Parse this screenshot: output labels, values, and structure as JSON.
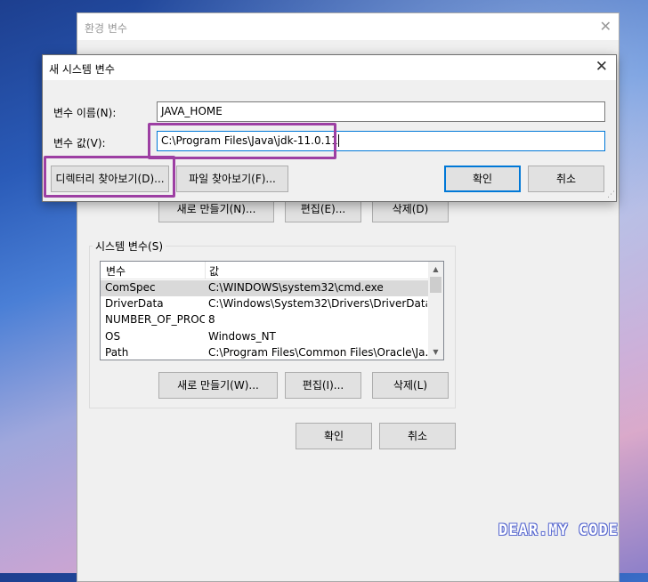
{
  "env_window": {
    "title": "환경 변수",
    "user_section": {
      "new_label": "새로 만들기(N)...",
      "edit_label": "편집(E)...",
      "delete_label": "삭제(D)"
    },
    "system_section": {
      "group_label": "시스템 변수(S)",
      "columns": [
        "변수",
        "값"
      ],
      "rows": [
        {
          "name": "ComSpec",
          "value": "C:\\WINDOWS\\system32\\cmd.exe"
        },
        {
          "name": "DriverData",
          "value": "C:\\Windows\\System32\\Drivers\\DriverData"
        },
        {
          "name": "NUMBER_OF_PROC...",
          "value": "8"
        },
        {
          "name": "OS",
          "value": "Windows_NT"
        },
        {
          "name": "Path",
          "value": "C:\\Program Files\\Common Files\\Oracle\\Ja..."
        }
      ],
      "new_label": "새로 만들기(W)...",
      "edit_label": "편집(I)...",
      "delete_label": "삭제(L)"
    },
    "ok_label": "확인",
    "cancel_label": "취소"
  },
  "dialog": {
    "title": "새 시스템 변수",
    "name_label": "변수 이름(N):",
    "name_value": "JAVA_HOME",
    "value_label": "변수 값(V):",
    "value_value": "C:\\Program Files\\Java\\jdk-11.0.11",
    "browse_dir_label": "디렉터리 찾아보기(D)...",
    "browse_file_label": "파일 찾아보기(F)...",
    "ok_label": "확인",
    "cancel_label": "취소"
  },
  "highlight_color": "#9d3fa3",
  "watermark": "DEAR.MY CODE"
}
